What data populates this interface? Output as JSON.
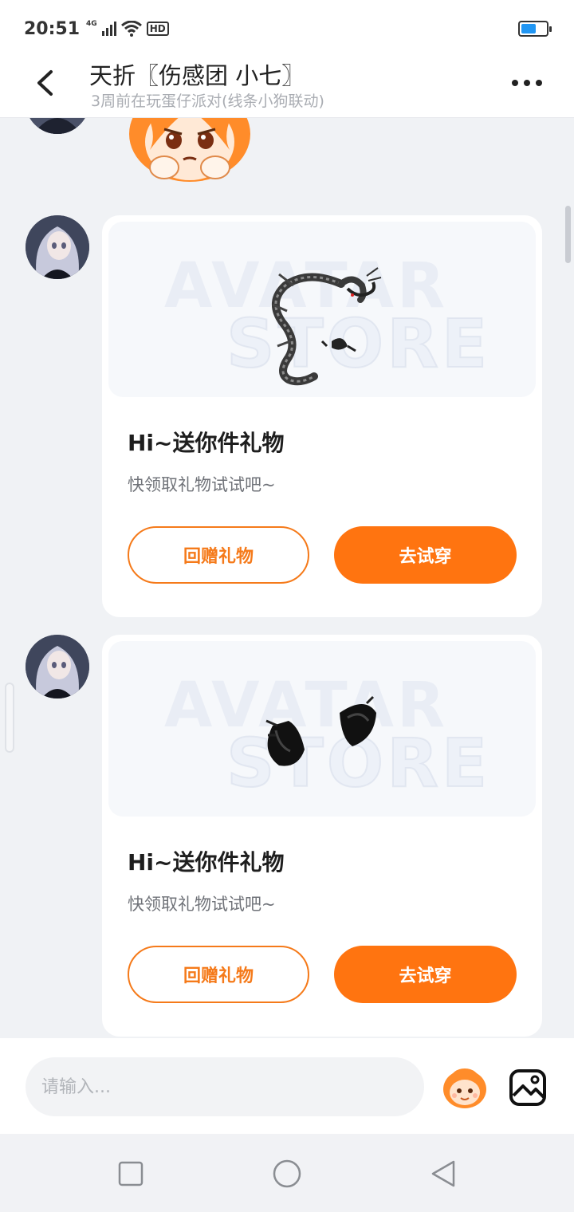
{
  "status_bar": {
    "time": "20:51",
    "network": "4G",
    "hd": "HD",
    "battery_level": 0.6
  },
  "header": {
    "title": "天折〖伤感团   小七〗",
    "subtitle": "3周前在玩蛋仔派对(线条小狗联动)"
  },
  "messages": [
    {
      "type": "sticker",
      "sticker_icon": "crying-eggy-sticker"
    },
    {
      "type": "gift",
      "watermark_top": "AVATAR",
      "watermark_bottom": "STORE",
      "item_icon": "black-dragon-icon",
      "title": "Hi~送你件礼物",
      "desc": "快领取礼物试试吧~",
      "return_label": "回赠礼物",
      "try_label": "去试穿"
    },
    {
      "type": "gift",
      "watermark_top": "AVATAR",
      "watermark_bottom": "STORE",
      "item_icon": "black-cat-ears-icon",
      "title": "Hi~送你件礼物",
      "desc": "快领取礼物试试吧~",
      "return_label": "回赠礼物",
      "try_label": "去试穿"
    }
  ],
  "input_bar": {
    "placeholder": "请输入..."
  },
  "colors": {
    "accent": "#ff7410",
    "accent_outline": "#f57a1a",
    "chat_bg": "#f0f2f5",
    "battery": "#2196f3"
  }
}
